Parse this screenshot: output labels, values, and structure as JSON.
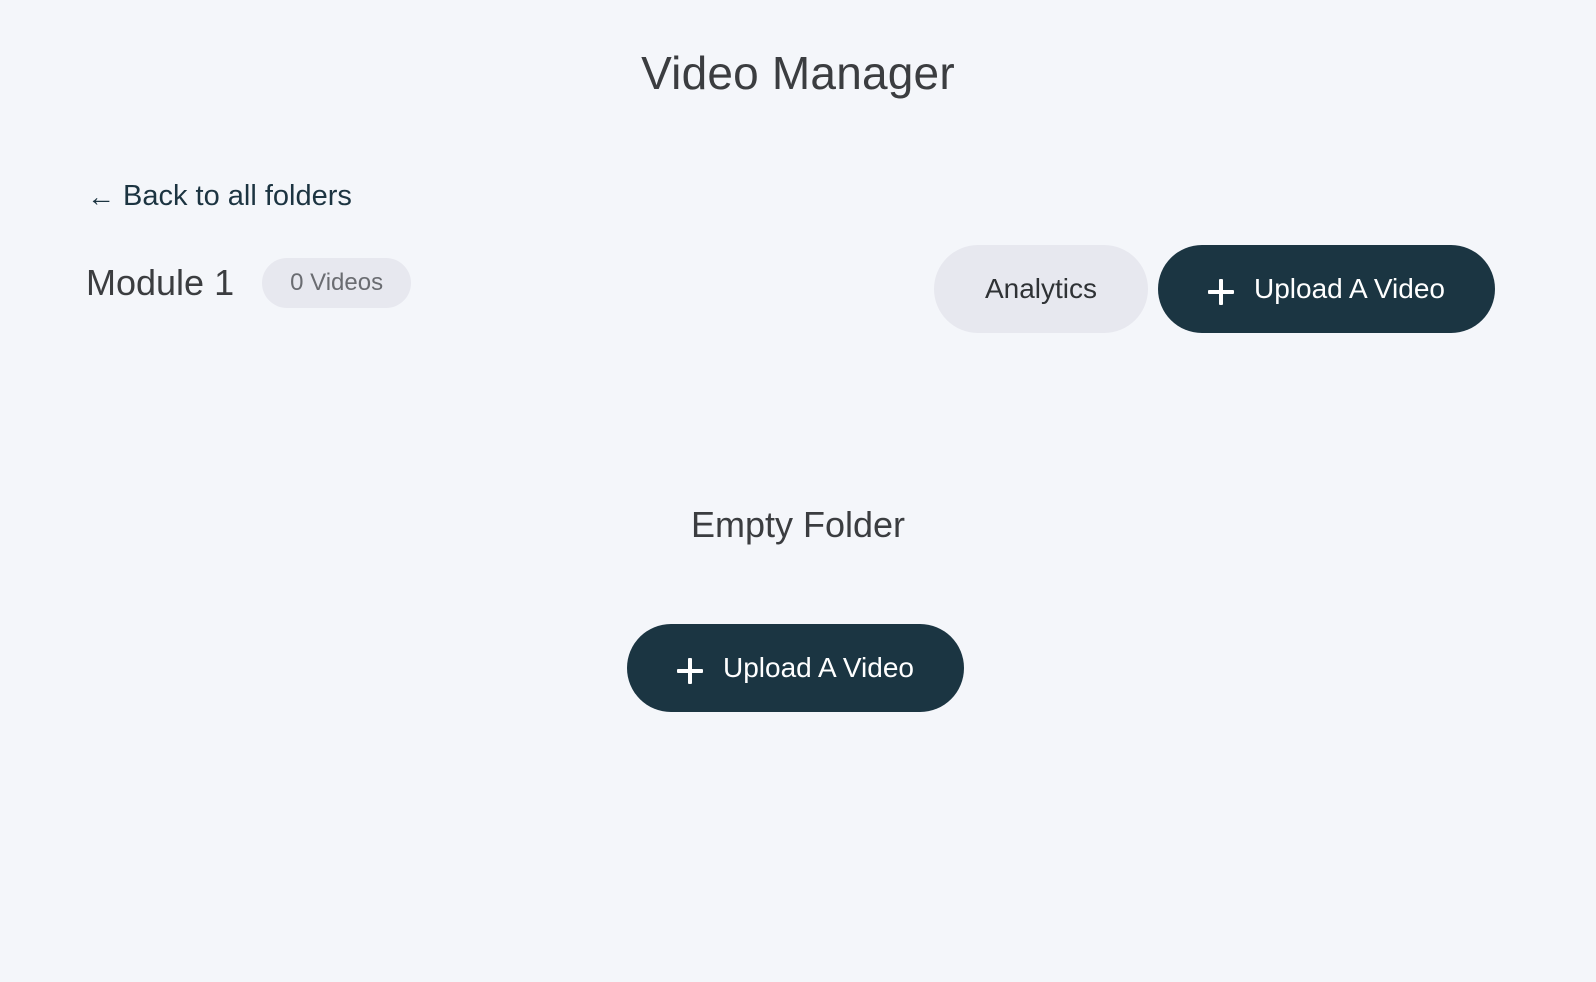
{
  "page": {
    "title": "Video Manager"
  },
  "nav": {
    "back_arrow": "←",
    "back_label": "Back to all folders"
  },
  "folder": {
    "name": "Module 1",
    "count_label": "0 Videos"
  },
  "toolbar": {
    "analytics_label": "Analytics",
    "upload_label": "Upload A Video"
  },
  "empty_state": {
    "title": "Empty Folder",
    "upload_label": "Upload A Video"
  },
  "colors": {
    "background": "#f4f6fa",
    "primary_button": "#1b3542",
    "secondary_button": "#e7e8ef",
    "text": "#3b3d40",
    "link": "#1c3441"
  },
  "icons": {
    "back": "arrow-left-icon",
    "upload": "plus-icon"
  }
}
